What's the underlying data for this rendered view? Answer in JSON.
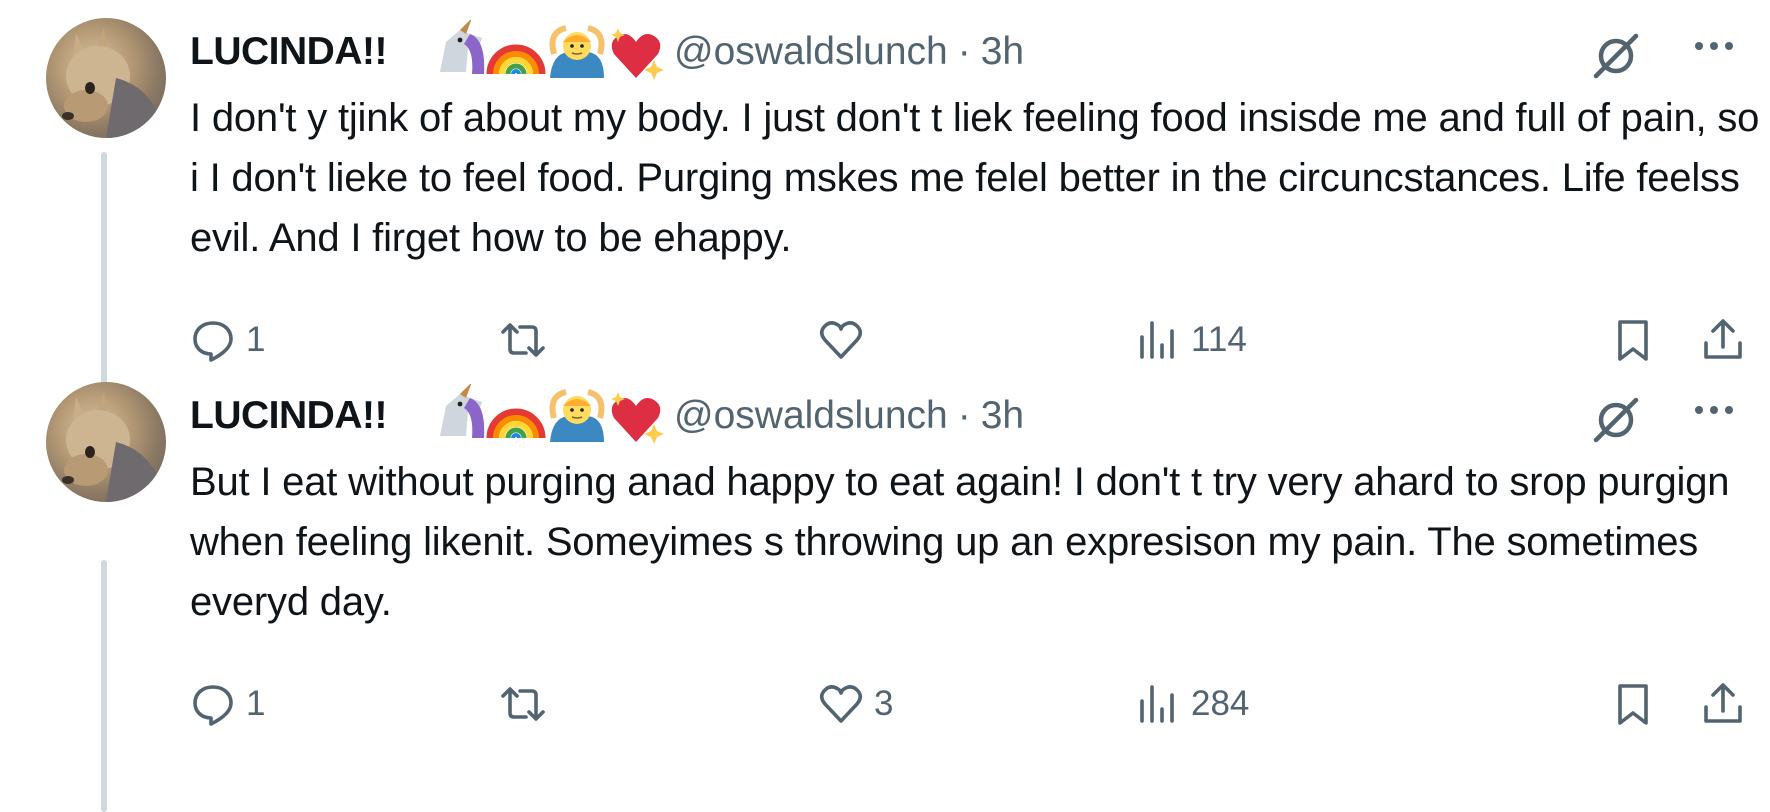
{
  "tweets": [
    {
      "name": "LUCINDA!!",
      "emojis": [
        "unicorn",
        "rainbow",
        "person-gesturing-ok",
        "sparkling-heart"
      ],
      "handle": "@oswaldslunch",
      "separator": "·",
      "time": "3h",
      "text": "I don't y tjink of about my body. I just don't t liek feeling food insisde me and full of pain, so i I don't lieke to feel food. Purging mskes me felel better in the circuncstances. Life feelss evil. And I firget how to be ehappy.",
      "replies": "1",
      "reposts": "",
      "likes": "",
      "views": "114"
    },
    {
      "name": "LUCINDA!!",
      "emojis": [
        "unicorn",
        "rainbow",
        "person-gesturing-ok",
        "sparkling-heart"
      ],
      "handle": "@oswaldslunch",
      "separator": "·",
      "time": "3h",
      "text": "But I eat without purging anad happy to eat again! I don't t try very ahard to srop purgign when feeling likenit. Someyimes s throwing up an expresison my pain. The sometimes everyd day.",
      "replies": "1",
      "reposts": "",
      "likes": "3",
      "views": "284"
    }
  ],
  "colors": {
    "text": "#0f1419",
    "secondary": "#536471",
    "thread_line": "#cfd9de",
    "background": "#ffffff"
  }
}
